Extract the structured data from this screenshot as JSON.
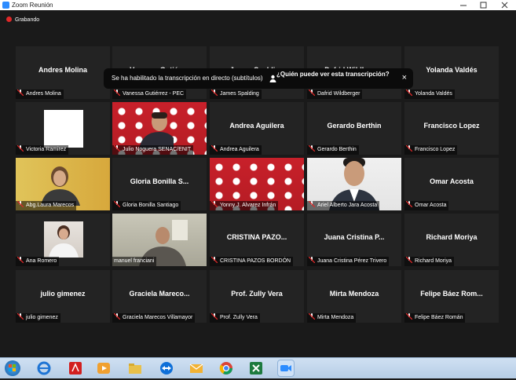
{
  "window": {
    "title": "Zoom Reunión"
  },
  "recording": {
    "label": "Grabando"
  },
  "banner": {
    "message": "Se ha habilitado la transcripción en directo (subtítulos)",
    "question": "¿Quién puede ver esta transcripción?",
    "close": "×"
  },
  "tiles": [
    {
      "name": "Andres Molina",
      "label": "Andres Molina"
    },
    {
      "name": "Vanessa Gutiérr...",
      "label": "Vanessa Gutiérrez - PEC"
    },
    {
      "name": "James Spalding",
      "label": "James Spalding"
    },
    {
      "name": "Dafrid Wildberger",
      "label": "Dafrid Wildberger"
    },
    {
      "name": "Yolanda Valdés",
      "label": "Yolanda Valdés"
    },
    {
      "name": "",
      "label": "Victoria Ramirez"
    },
    {
      "name": "",
      "label": "Julio Noguera SENAC/ENIT"
    },
    {
      "name": "Andrea Aguilera",
      "label": "Andrea Aguilera"
    },
    {
      "name": "Gerardo Berthin",
      "label": "Gerardo Berthin"
    },
    {
      "name": "Francisco Lopez",
      "label": "Francisco Lopez"
    },
    {
      "name": "",
      "label": "Abg.Laura Marecos"
    },
    {
      "name": "Gloria Bonilla S...",
      "label": "Gloria Bonilla Santiago"
    },
    {
      "name": "",
      "label": "Yonny J. Alvarez Infrán"
    },
    {
      "name": "",
      "label": "Ariel Alberto Jara Acosta"
    },
    {
      "name": "Omar Acosta",
      "label": "Omar Acosta"
    },
    {
      "name": "",
      "label": "Ana Romero"
    },
    {
      "name": "",
      "label": "manuel franciani"
    },
    {
      "name": "CRISTINA PAZO...",
      "label": "CRISTINA PAZOS BORDÓN"
    },
    {
      "name": "Juana Cristina P...",
      "label": "Juana Cristina Pérez Trivero"
    },
    {
      "name": "Richard Moriya",
      "label": "Richard Moriya"
    },
    {
      "name": "julio gimenez",
      "label": "julio gimenez"
    },
    {
      "name": "Graciela Mareco...",
      "label": "Graciela Marecos Villamayor"
    },
    {
      "name": "Prof. Zully Vera",
      "label": "Prof. Zully Vera"
    },
    {
      "name": "Mirta Mendoza",
      "label": "Mirta Mendoza"
    },
    {
      "name": "Felipe Báez Rom...",
      "label": "Felipe Báez Román"
    }
  ],
  "colors": {
    "speaking_border": "#c9e37a",
    "mute": "#e02828",
    "accent": "#2d8cff"
  }
}
